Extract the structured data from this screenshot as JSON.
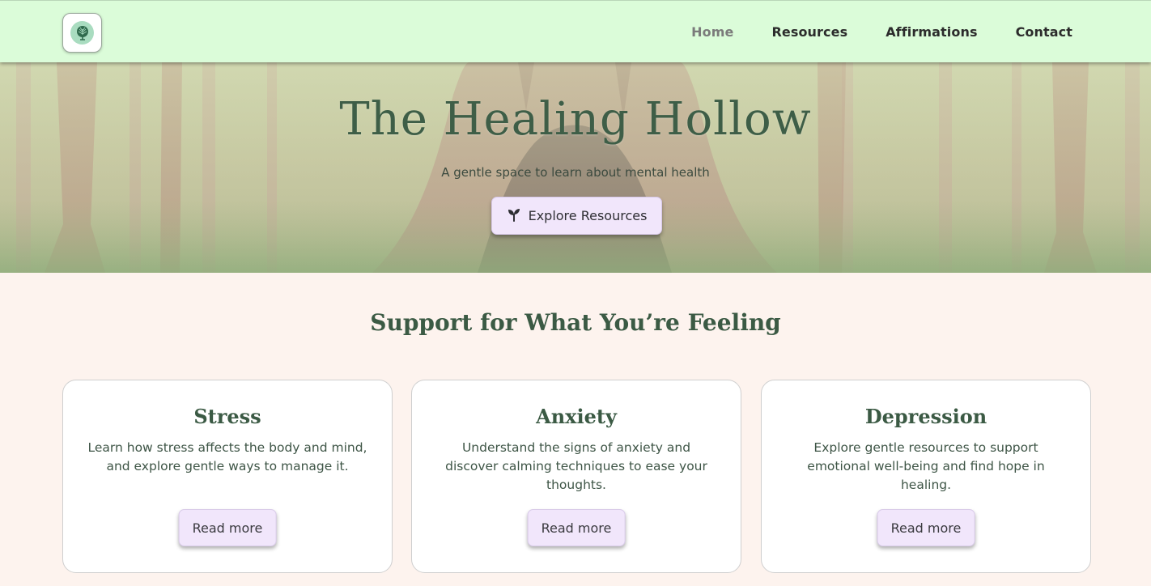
{
  "nav": {
    "logo_icon": "tree-icon",
    "links": [
      "Home",
      "Resources",
      "Affirmations",
      "Contact"
    ],
    "active": "Home"
  },
  "hero": {
    "title": "The Healing Hollow",
    "subtitle": "A gentle space to learn about mental health",
    "button_icon": "sprout-icon",
    "button_label": "Explore Resources"
  },
  "section": {
    "title": "Support for What You’re Feeling"
  },
  "cards": [
    {
      "title": "Stress",
      "text": "Learn how stress affects the body and mind, and explore gentle ways to manage it.",
      "button": "Read more"
    },
    {
      "title": "Anxiety",
      "text": "Understand the signs of anxiety and discover calming techniques to ease your thoughts.",
      "button": "Read more"
    },
    {
      "title": "Depression",
      "text": "Explore gentle resources to support emotional well-being and find hope in healing.",
      "button": "Read more"
    }
  ],
  "colors": {
    "navbar": "#dbfcd9",
    "page_background": "#fdf3ee",
    "button": "#f1e6fb",
    "heading": "#3e5e47"
  }
}
